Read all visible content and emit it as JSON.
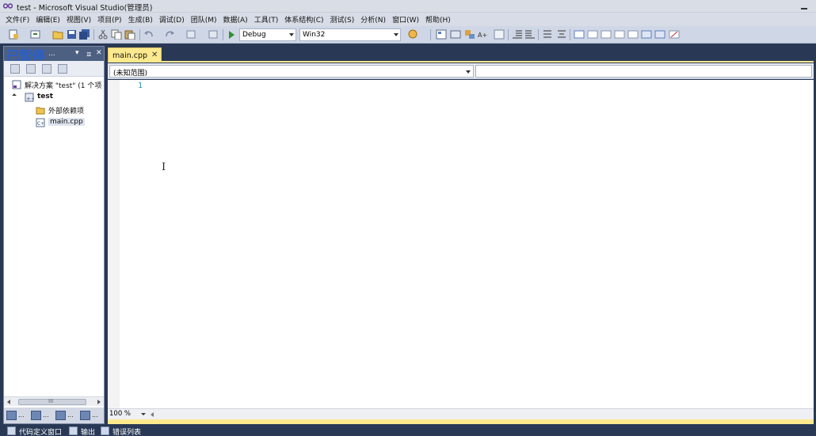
{
  "window": {
    "title": "test - Microsoft Visual Studio(管理员)"
  },
  "menubar": {
    "items": [
      "文件(F)",
      "编辑(E)",
      "视图(V)",
      "项目(P)",
      "生成(B)",
      "调试(D)",
      "团队(M)",
      "数据(A)",
      "工具(T)",
      "体系结构(C)",
      "测试(S)",
      "分析(N)",
      "窗口(W)",
      "帮助(H)"
    ]
  },
  "toolbar": {
    "config": "Debug",
    "platform": "Win32"
  },
  "sidebar": {
    "paused_label": "已暂停",
    "header_title": "...",
    "pin_glyph": "ㅍ",
    "close_glyph": "✕",
    "dropdown_glyph": "▾",
    "tree": {
      "solution": "解决方案 \"test\" (1 个项",
      "project": "test",
      "external_deps": "外部依赖项",
      "file": "main.cpp"
    },
    "scroll_grip": "III",
    "tabs": [
      "...",
      "...",
      "...",
      "..."
    ]
  },
  "document": {
    "tab_label": "main.cpp",
    "tab_close": "✕",
    "scope_combo": "(未知范围)",
    "line_number": "1",
    "cursor_glyph": "I"
  },
  "status": {
    "zoom": "100 %"
  },
  "bottom_tabs": {
    "code_definition": "代码定义窗口",
    "output": "输出",
    "error_list": "错误列表"
  },
  "colors": {
    "chrome": "#293955",
    "accent": "#fde98e",
    "line_number": "#2b91af"
  }
}
